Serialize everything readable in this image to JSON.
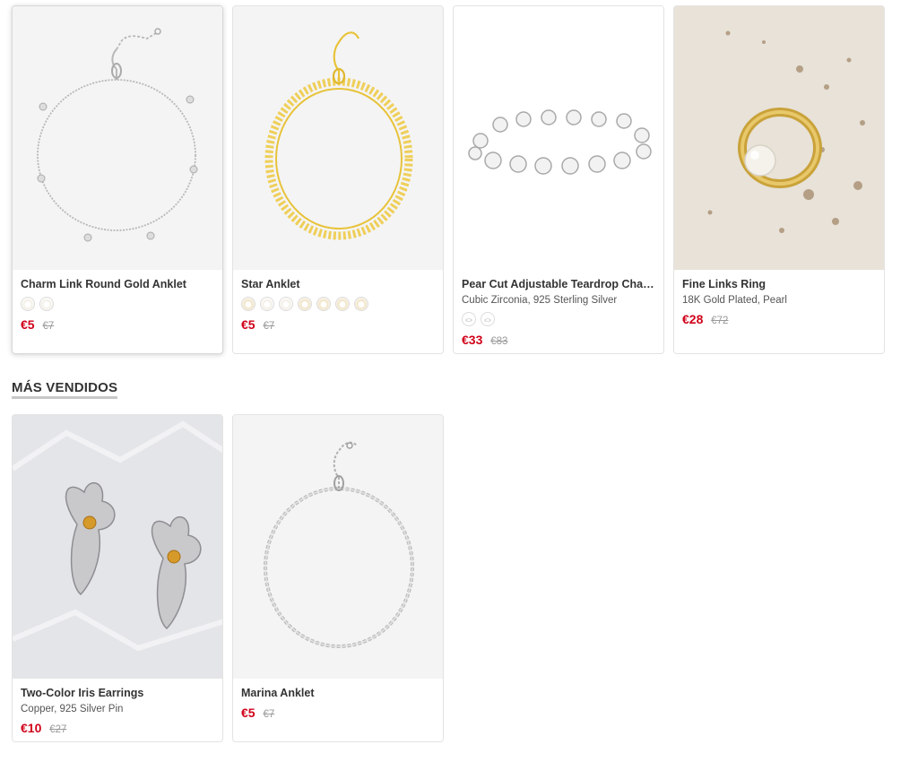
{
  "products_row1": [
    {
      "name": "Charm Link Round Gold Anklet",
      "sub": "",
      "price": "€5",
      "old_price": "€7",
      "swatches": 2,
      "image_icon": "silver-charm-anklet"
    },
    {
      "name": "Star Anklet",
      "sub": "",
      "price": "€5",
      "old_price": "€7",
      "swatches": 7,
      "image_icon": "gold-star-anklet"
    },
    {
      "name": "Pear Cut Adjustable Teardrop Chain…",
      "sub": "Cubic Zirconia, 925 Sterling Silver",
      "price": "€33",
      "old_price": "€83",
      "swatches": 2,
      "image_icon": "teardrop-bracelet"
    },
    {
      "name": "Fine Links Ring",
      "sub": "18K Gold Plated, Pearl",
      "price": "€28",
      "old_price": "€72",
      "swatches": 0,
      "image_icon": "pearl-gold-ring"
    }
  ],
  "section": {
    "title": "MÁS VENDIDOS"
  },
  "products_row2": [
    {
      "name": "Two-Color Iris Earrings",
      "sub": "Copper, 925 Silver Pin",
      "price": "€10",
      "old_price": "€27",
      "swatches": 0,
      "image_icon": "iris-earrings"
    },
    {
      "name": "Marina Anklet",
      "sub": "",
      "price": "€5",
      "old_price": "€7",
      "swatches": 0,
      "image_icon": "silver-chain-anklet"
    }
  ],
  "colors": {
    "price": "#d0021b",
    "gold": "#e8c33a",
    "silver": "#b9b9b9"
  }
}
